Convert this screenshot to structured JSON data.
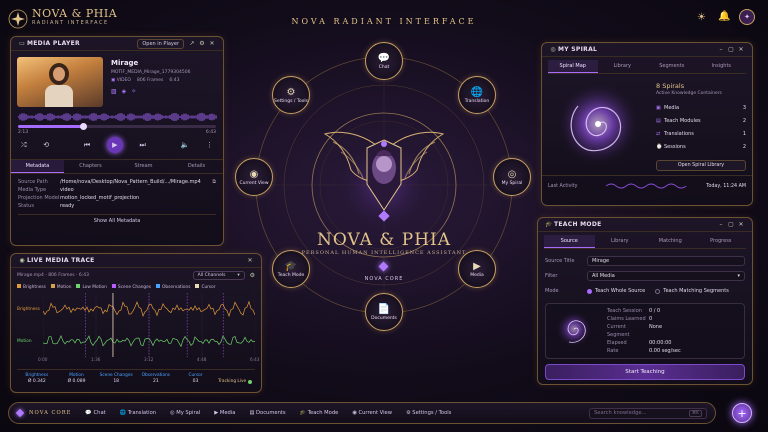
{
  "app": {
    "title": "NOVA & PHIA",
    "subtitle": "RADIANT INTERFACE",
    "center_title": "NOVA RADIANT INTERFACE",
    "hero_title": "NOVA & PHIA",
    "hero_subtitle": "PERSONAL HUMAN INTELLIGENCE ASSISTANT",
    "core_label": "NOVA CORE"
  },
  "top_icons": [
    "sun-icon",
    "bell-icon",
    "avatar"
  ],
  "media_player": {
    "title": "MEDIA PLAYER",
    "open_button": "Open in Player",
    "track_title": "Mirage",
    "track_file": "MOTIF_MEDIA_Mirage_1779304506",
    "track_meta_1": "VIDEO",
    "track_meta_2": "806 Frames",
    "track_meta_3": "6:43",
    "time_current": "2:13",
    "time_total": "6:43",
    "progress": 0.33,
    "tabs": [
      "Metadata",
      "Chapters",
      "Stream",
      "Details"
    ],
    "active_tab": 0,
    "rows": [
      {
        "k": "Source Path",
        "v": "/Home/nova/Desktop/Nova_Pattern_Build/.../Mirage.mp4"
      },
      {
        "k": "Media Type",
        "v": "video"
      },
      {
        "k": "Projection Model",
        "v": "motion_locked_motif_projection"
      },
      {
        "k": "Status",
        "v": "ready"
      }
    ],
    "show_all": "Show All Metadata"
  },
  "live_trace": {
    "title": "LIVE MEDIA TRACE",
    "file_info": "Mirage.mp4  ·  806 Frames  ·  6:43",
    "channel_select": "All Channels",
    "legend": [
      {
        "name": "Brightness",
        "color": "#e09a3a"
      },
      {
        "name": "Motion",
        "color": "#d4a24a"
      },
      {
        "name": "Low Motion",
        "color": "#6ed36a"
      },
      {
        "name": "Scene Changes",
        "color": "#b85cff"
      },
      {
        "name": "Observations",
        "color": "#4aa3ff"
      },
      {
        "name": "Cursor",
        "color": "#e8d9b5"
      }
    ],
    "y_labels": [
      "Brightness",
      "Motion"
    ],
    "x_ticks": [
      "0:00",
      "1:36",
      "3:12",
      "4:48",
      "6:43"
    ],
    "stats": [
      {
        "label": "Brightness",
        "value": "Ø 0.342"
      },
      {
        "label": "Motion",
        "value": "Ø 0.089"
      },
      {
        "label": "Scene Changes",
        "value": "18"
      },
      {
        "label": "Observations",
        "value": "21"
      },
      {
        "label": "Cursor",
        "value": "03"
      }
    ],
    "tracking": "Tracking Live"
  },
  "nodes": {
    "chat": "Chat",
    "settings": "Settings / Tools",
    "translation": "Translation",
    "current_view": "Current View",
    "my_spiral": "My Spiral",
    "teach_mode": "Teach Mode",
    "media": "Media",
    "documents": "Documents"
  },
  "my_spiral": {
    "title": "MY SPIRAL",
    "tabs": [
      "Spiral Map",
      "Library",
      "Segments",
      "Insights"
    ],
    "active_tab": 0,
    "count_title": "8 Spirals",
    "count_sub": "Active Knowledge Containers",
    "items": [
      {
        "label": "Media",
        "count": "3"
      },
      {
        "label": "Teach Modules",
        "count": "2"
      },
      {
        "label": "Translations",
        "count": "1"
      },
      {
        "label": "Sessions",
        "count": "2"
      }
    ],
    "open_button": "Open Spiral Library",
    "last_activity_label": "Last Activity",
    "last_activity_value": "Today, 11:24 AM"
  },
  "teach_mode": {
    "title": "TEACH MODE",
    "tabs": [
      "Source",
      "Library",
      "Matching",
      "Progress"
    ],
    "active_tab": 0,
    "source_title_label": "Source Title",
    "source_title_value": "Mirage",
    "filter_label": "Filter",
    "filter_value": "All Media",
    "mode_label": "Mode",
    "mode_opt_1": "Teach Whole Source",
    "mode_opt_2": "Teach Matching Segments",
    "session": [
      {
        "k": "Teach Session",
        "v": "0 / 0"
      },
      {
        "k": "Claims Learned",
        "v": "0"
      },
      {
        "k": "Current Segment",
        "v": "None"
      },
      {
        "k": "Elapsed",
        "v": "00:00:00"
      },
      {
        "k": "Rate",
        "v": "0.00 seg/sec"
      }
    ],
    "start_button": "Start Teaching"
  },
  "bottom_nav": {
    "brand": "NOVA CORE",
    "items": [
      "Chat",
      "Translation",
      "My Spiral",
      "Media",
      "Documents",
      "Teach Mode",
      "Current View",
      "Settings / Tools"
    ],
    "search_placeholder": "Search knowledge...",
    "search_hint": "⌘K"
  }
}
